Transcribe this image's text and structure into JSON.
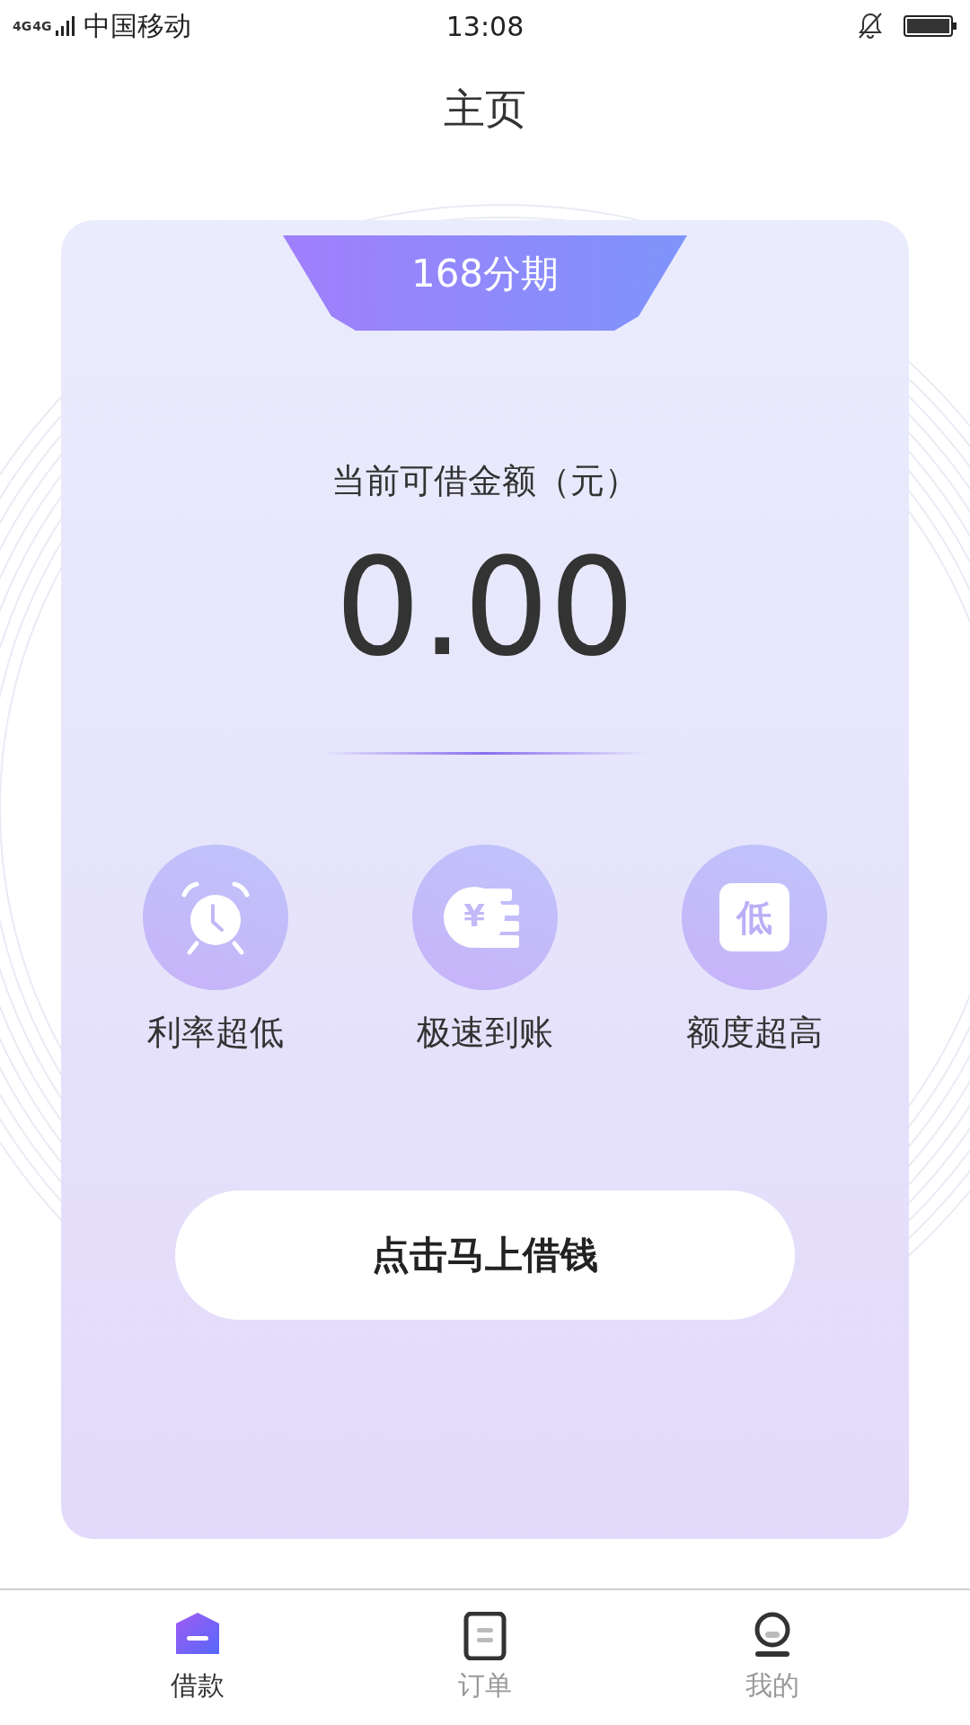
{
  "status_bar": {
    "network": "4G",
    "network2": "4G",
    "carrier": "中国移动",
    "time": "13:08"
  },
  "header": {
    "title": "主页"
  },
  "card": {
    "tab_label": "168分期",
    "amount_label": "当前可借金额（元）",
    "amount": "0.00",
    "features": [
      {
        "kind": "clock",
        "label": "利率超低"
      },
      {
        "kind": "coin",
        "label": "极速到账",
        "icon_text": "¥"
      },
      {
        "kind": "badge",
        "label": "额度超高",
        "icon_text": "低"
      }
    ],
    "action": "点击马上借钱"
  },
  "tab_bar": [
    {
      "kind": "home",
      "label": "借款",
      "selected": true
    },
    {
      "kind": "doc",
      "label": "订单",
      "selected": false
    },
    {
      "kind": "user",
      "label": "我的",
      "selected": false
    }
  ]
}
